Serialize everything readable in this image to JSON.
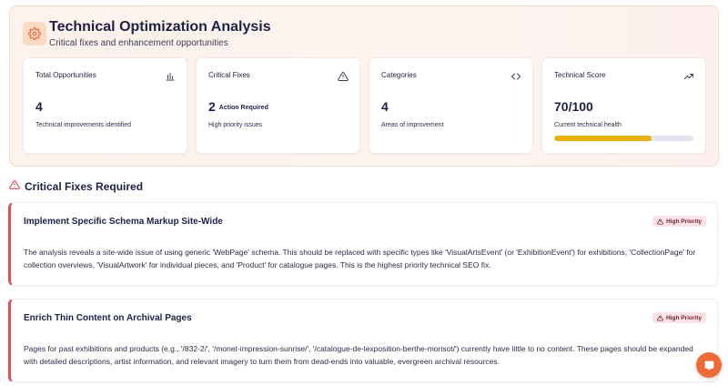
{
  "header": {
    "title": "Technical Optimization Analysis",
    "subtitle": "Critical fixes and enhancement opportunities",
    "icon": "gear-icon",
    "accent_color": "#ef6a37"
  },
  "cards": [
    {
      "title": "Total Opportunities",
      "value": "4",
      "badge": "",
      "description": "Technical improvements identified",
      "icon": "bar-chart-icon"
    },
    {
      "title": "Critical Fixes",
      "value": "2",
      "badge": "Action Required",
      "description": "High priority issues",
      "icon": "warning-icon"
    },
    {
      "title": "Categories",
      "value": "4",
      "badge": "",
      "description": "Areas of improvement",
      "icon": "code-icon"
    },
    {
      "title": "Technical Score",
      "value": "70/100",
      "badge": "",
      "description": "Current technical health",
      "icon": "trending-up-icon",
      "progress": 0.7,
      "progress_color": "#e4b40c"
    }
  ],
  "section": {
    "title": "Critical Fixes Required",
    "icon": "warning-icon",
    "icon_color": "#e54e59"
  },
  "fixes": [
    {
      "title": "Implement Specific Schema Markup Site-Wide",
      "badge": "High Priority",
      "body": "The analysis reveals a site-wide issue of using generic 'WebPage' schema. This should be replaced with specific types like 'VisualArtsEvent' (or 'ExhibitionEvent') for exhibitions, 'CollectionPage' for collection overviews, 'VisualArtwork' for individual pieces, and 'Product' for catalogue pages. This is the highest priority technical SEO fix."
    },
    {
      "title": "Enrich Thin Content on Archival Pages",
      "badge": "High Priority",
      "body": "Pages for past exhibitions and products (e.g., '/832-2/', '/monet-impression-sunrise/', '/catalogue-de-lexposition-berthe-morisot/') currently have little to no content. These pages should be expanded with detailed descriptions, artist information, and relevant imagery to turn them from dead-ends into valuable, evergreen archival resources."
    }
  ],
  "chat_button": {
    "icon": "chat-icon"
  }
}
